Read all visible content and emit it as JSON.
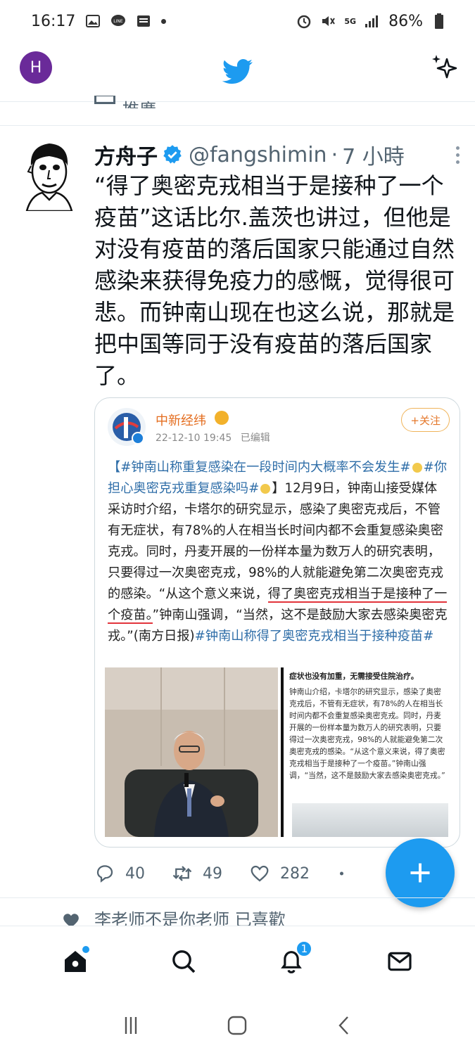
{
  "status_bar": {
    "time": "16:17",
    "battery": "86%",
    "network": "5G"
  },
  "app": {
    "account_initial": "H"
  },
  "previous_item": {
    "text": "推廣"
  },
  "tweet": {
    "author_name": "方舟子",
    "handle": "@fangshimin",
    "time_sep": "·",
    "time": "7 小時",
    "text": "“得了奥密克戎相当于是接种了一个疫苗”这话比尔.盖茨也讲过，但他是对没有疫苗的落后国家只能通过自然感染来获得免疫力的感慨，觉得很可悲。而钟南山现在也这么说，那就是把中国等同于没有疫苗的落后国家了。",
    "replies": "40",
    "retweets": "49",
    "likes": "282"
  },
  "quoted": {
    "source_name": "中新经纬",
    "date": "22-12-10 19:45",
    "edited": "已编辑",
    "follow_label": "+关注",
    "hashtag1": "【#钟南山称重复感染在一段时间内大概率不会发生#",
    "hashtag2": "#你担心奥密克戎重复感染吗#",
    "body1": "】12月9日，钟南山接受媒体采访时介绍，卡塔尔的研究显示，感染了奥密克戎后，不管有无症状，有78%的人在相当长时间内都不会重复感染奥密克戎。同时，丹麦开展的一份样本量为数万人的研究表明，只要得过一次奥密克戎，98%的人就能避免第二次奥密克戎的感染。“从这个意义来说，",
    "underlined": "得了奥密克戎相当于是接种了一个疫苗。",
    "body2": "”钟南山强调，“当然，这不是鼓励大家去感染奥密克戎。”(南方日报)",
    "hashtag3": "#钟南山称得了奥密克戎相当于接种疫苗#",
    "screenshot_title": "症状也没有加重，无需接受住院治疗。",
    "screenshot_text": "钟南山介绍，卡塔尔的研究显示，感染了奥密克戎后，不管有无症状，有78%的人在相当长时间内都不会重复感染奥密克戎。同时，丹麦开展的一份样本量为数万人的研究表明，只要得过一次奥密克戎，98%的人就能避免第二次奥密克戎的感染。“从这个意义来说，得了奥密克戎相当于是接种了一个疫苗。”钟南山强调，“当然，这不是鼓励大家去感染奥密克戎。”"
  },
  "next_item": {
    "text": "李老师不是你老师 已喜歡"
  },
  "bottom_nav": {
    "notification_count": "1"
  },
  "colors": {
    "twitter_blue": "#1d9bf0",
    "avatar_purple": "#6a2a99",
    "quote_orange": "#e46d1f",
    "underline_red": "#e2343b"
  }
}
